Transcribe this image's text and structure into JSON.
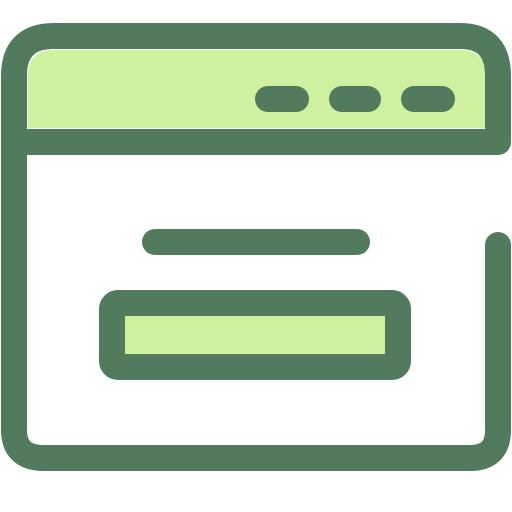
{
  "icon": {
    "name": "browser-window-form-icon",
    "colors": {
      "outline": "#527A5D",
      "fill_light": "#CFF09E",
      "background": "#FFFFFF"
    },
    "elements": {
      "title_bar": "title-bar",
      "window_controls": [
        "window-control-dot",
        "window-control-dot",
        "window-control-dot"
      ],
      "text_line": "text-line-placeholder",
      "input_box": "input-field-placeholder"
    }
  }
}
